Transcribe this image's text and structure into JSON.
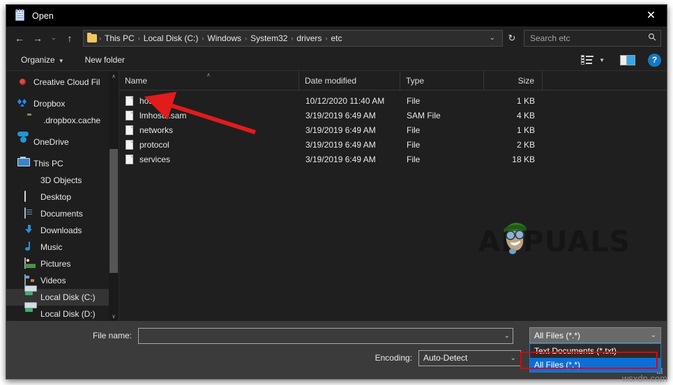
{
  "window": {
    "title": "Open",
    "icon": "notepad-icon",
    "close_label": "✕"
  },
  "nav": {
    "back": "←",
    "forward": "→",
    "recent": "⌄",
    "up": "↑",
    "breadcrumbs": [
      "This PC",
      "Local Disk (C:)",
      "Windows",
      "System32",
      "drivers",
      "etc"
    ],
    "separator": "›",
    "dropdown_caret": "⌄",
    "refresh": "↻"
  },
  "search": {
    "placeholder": "Search etc",
    "value": "",
    "icon": "🔍"
  },
  "commandbar": {
    "organize_label": "Organize",
    "organize_caret": "▼",
    "new_folder_label": "New folder",
    "view_caret": "▼",
    "help_label": "?"
  },
  "sidebar": {
    "items": [
      {
        "label": "Creative Cloud Fil",
        "icon": "creative-cloud-icon",
        "indent": 0,
        "selected": false
      },
      {
        "label": "Dropbox",
        "icon": "dropbox-icon",
        "indent": 0,
        "selected": false,
        "gap_before": true
      },
      {
        "label": ".dropbox.cache",
        "icon": "folder-icon",
        "indent": 1,
        "selected": false
      },
      {
        "label": "OneDrive",
        "icon": "onedrive-icon",
        "indent": 0,
        "selected": false,
        "gap_before": true
      },
      {
        "label": "This PC",
        "icon": "this-pc-icon",
        "indent": 0,
        "selected": false,
        "gap_before": true
      },
      {
        "label": "3D Objects",
        "icon": "3d-objects-icon",
        "indent": 1,
        "selected": false
      },
      {
        "label": "Desktop",
        "icon": "desktop-icon",
        "indent": 1,
        "selected": false
      },
      {
        "label": "Documents",
        "icon": "documents-icon",
        "indent": 1,
        "selected": false
      },
      {
        "label": "Downloads",
        "icon": "downloads-icon",
        "indent": 1,
        "selected": false
      },
      {
        "label": "Music",
        "icon": "music-icon",
        "indent": 1,
        "selected": false
      },
      {
        "label": "Pictures",
        "icon": "pictures-icon",
        "indent": 1,
        "selected": false
      },
      {
        "label": "Videos",
        "icon": "videos-icon",
        "indent": 1,
        "selected": false
      },
      {
        "label": "Local Disk (C:)",
        "icon": "disk-icon",
        "indent": 1,
        "selected": true
      },
      {
        "label": "Local Disk (D:)",
        "icon": "disk-icon",
        "indent": 1,
        "selected": false
      }
    ],
    "scroll_up": "∧",
    "scroll_down": "∨"
  },
  "filelist": {
    "columns": [
      {
        "label": "Name",
        "key": "name",
        "sorted": true,
        "sort_caret": "∧"
      },
      {
        "label": "Date modified",
        "key": "date"
      },
      {
        "label": "Type",
        "key": "type"
      },
      {
        "label": "Size",
        "key": "size"
      }
    ],
    "rows": [
      {
        "name": "hosts",
        "date": "10/12/2020 11:40 AM",
        "type": "File",
        "size": "1 KB"
      },
      {
        "name": "lmhosts.sam",
        "date": "3/19/2019 6:49 AM",
        "type": "SAM File",
        "size": "4 KB"
      },
      {
        "name": "networks",
        "date": "3/19/2019 6:49 AM",
        "type": "File",
        "size": "1 KB"
      },
      {
        "name": "protocol",
        "date": "3/19/2019 6:49 AM",
        "type": "File",
        "size": "2 KB"
      },
      {
        "name": "services",
        "date": "3/19/2019 6:49 AM",
        "type": "File",
        "size": "18 KB"
      }
    ],
    "watermark": "APPUALS"
  },
  "annotation": {
    "arrow_color": "#e21b1b",
    "highlight_color": "#e60000",
    "target": "hosts"
  },
  "footer": {
    "file_name_label": "File name:",
    "file_name_value": "",
    "file_name_caret": "⌄",
    "encoding_label": "Encoding:",
    "encoding_value": "Auto-Detect",
    "encoding_caret": "⌄",
    "filter_value": "All Files  (*.*)",
    "filter_caret": "⌄",
    "filter_options": [
      {
        "label": "Text Documents (*.txt)",
        "selected": false
      },
      {
        "label": "All Files  (*.*)",
        "selected": true
      }
    ]
  },
  "sitemark": "wsxdn.com"
}
